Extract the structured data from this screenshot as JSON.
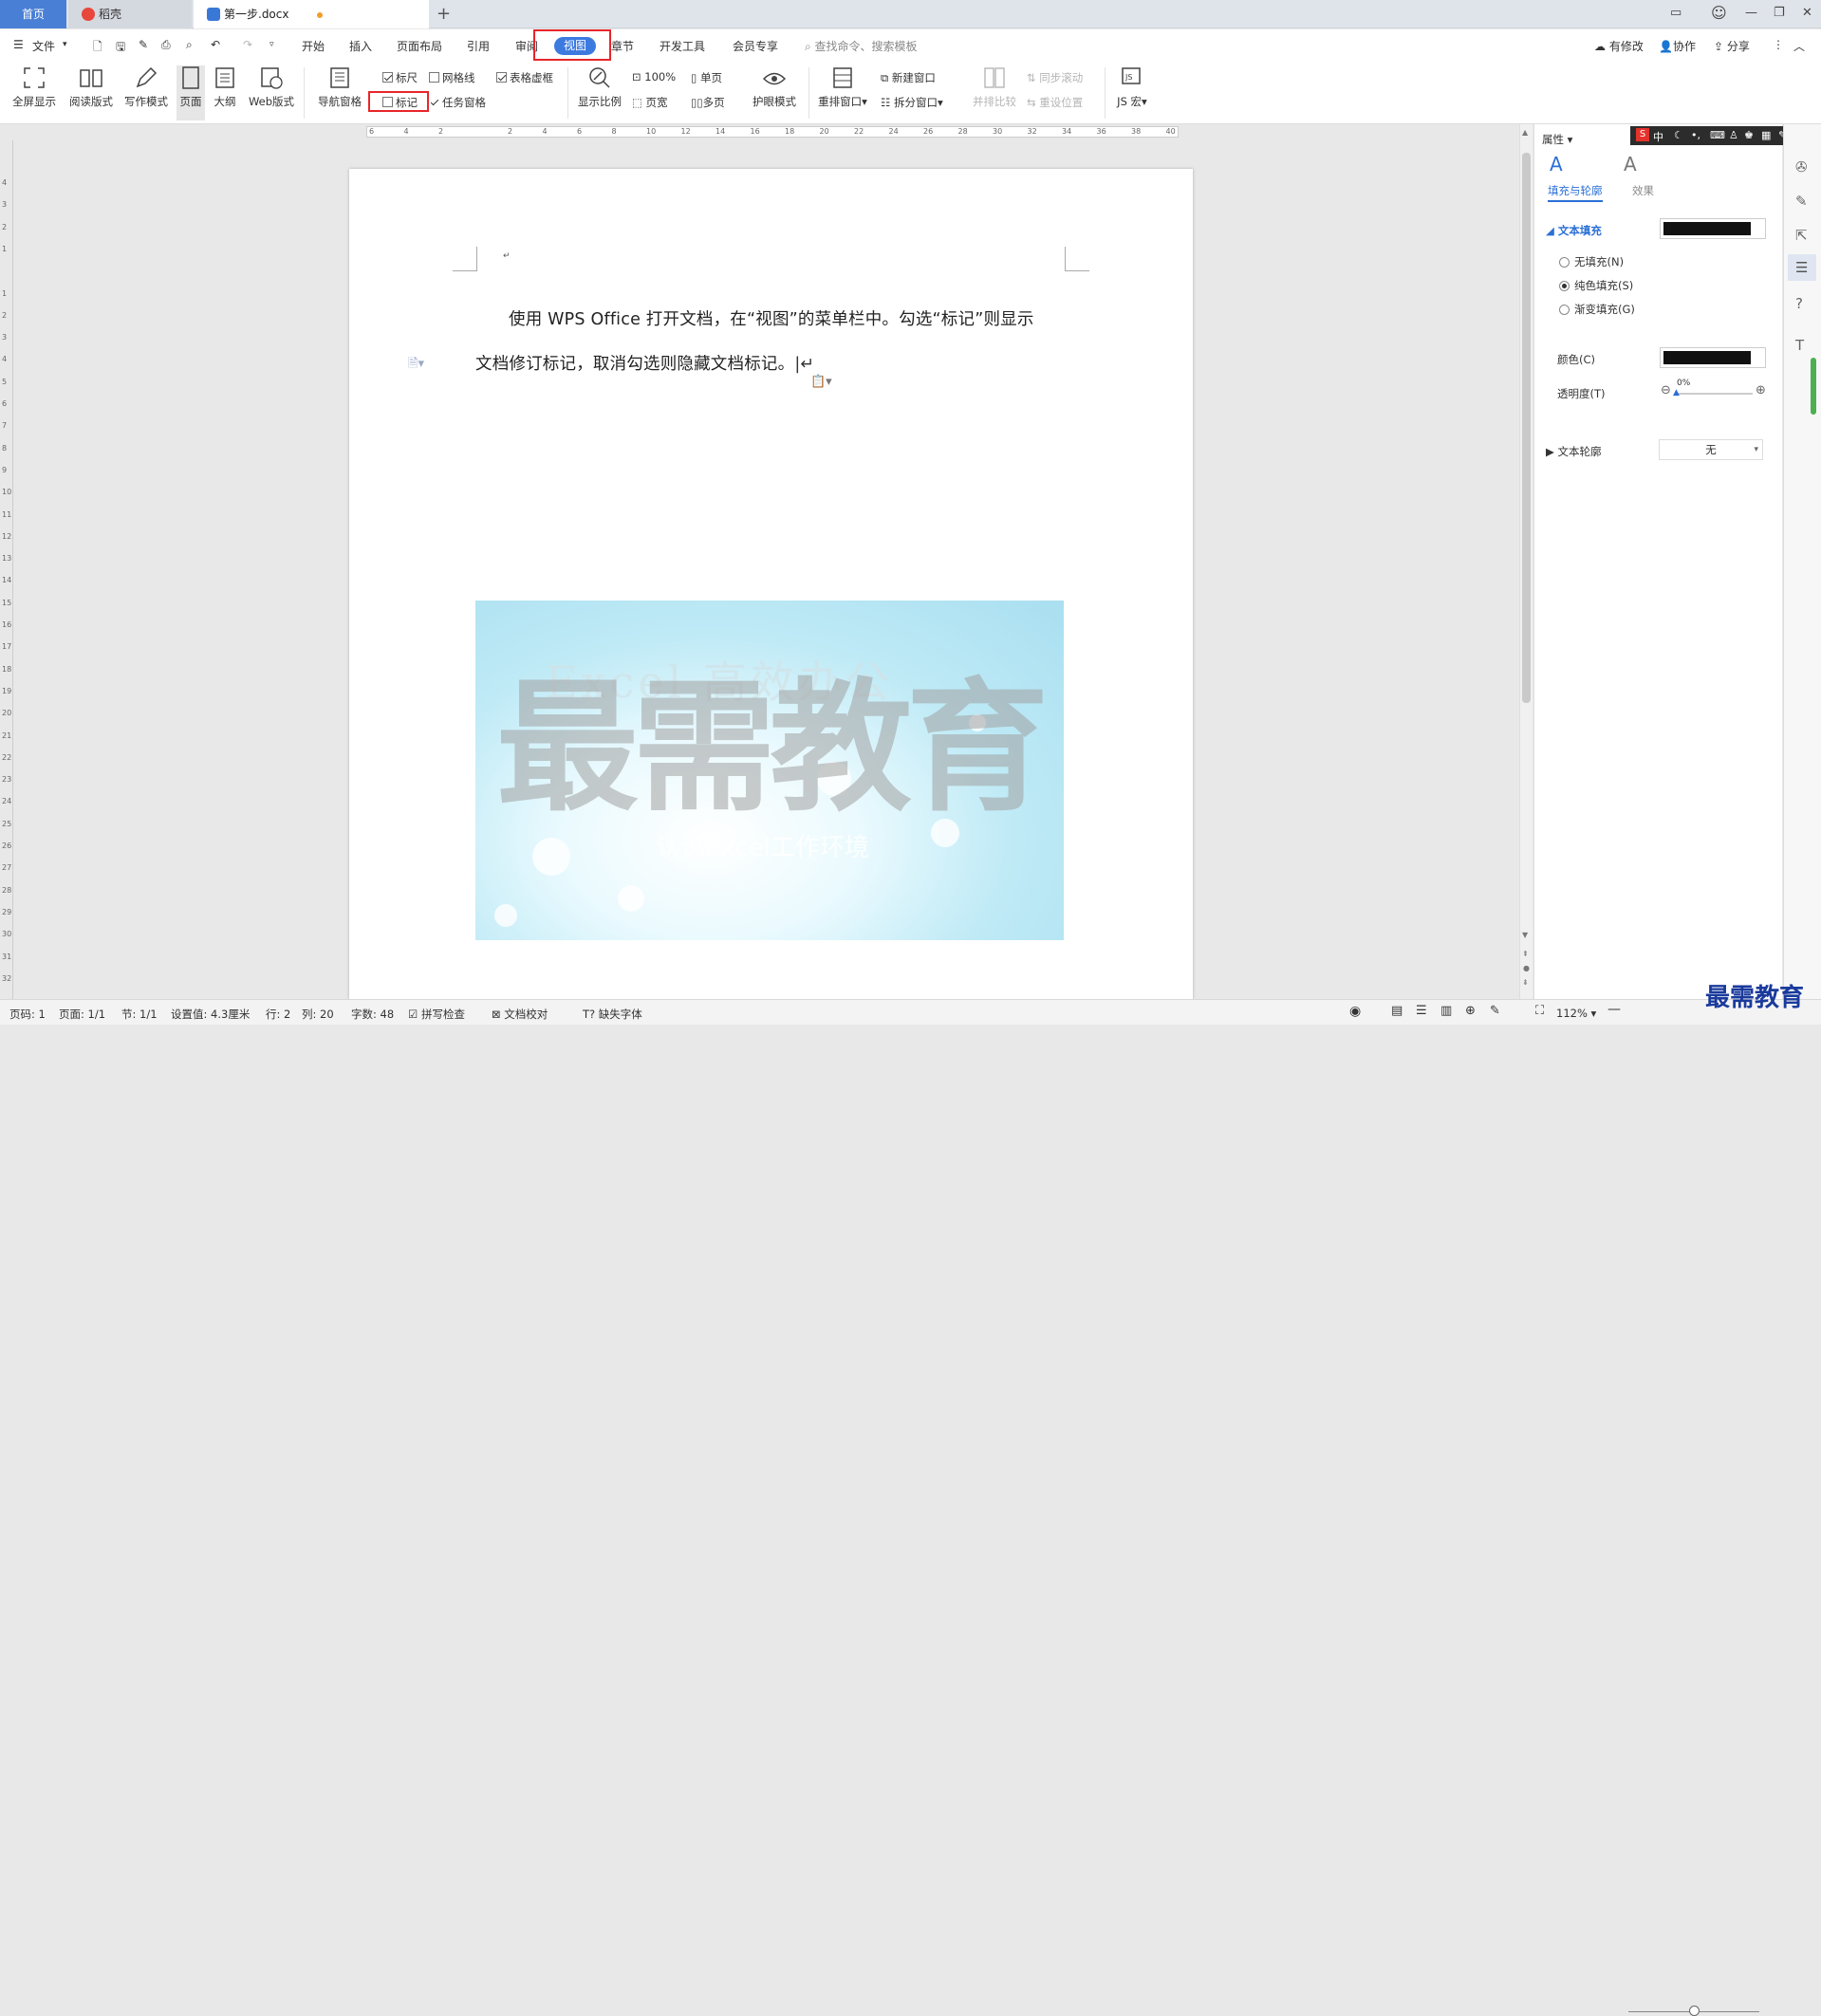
{
  "tabs": {
    "home": "首页",
    "daoke": "稻壳",
    "doc": "第一步.docx",
    "add": "+"
  },
  "menu": {
    "file": "文件",
    "items": [
      "开始",
      "插入",
      "页面布局",
      "引用",
      "审阅",
      "视图",
      "章节",
      "开发工具",
      "会员专享"
    ],
    "search": "查找命令、搜索模板",
    "right": [
      "有修改",
      "协作",
      "分享"
    ]
  },
  "ribbon": {
    "fullscreen": "全屏显示",
    "read": "阅读版式",
    "write": "写作模式",
    "page": "页面",
    "outline": "大纲",
    "web": "Web版式",
    "nav": "导航窗格",
    "ruler": "标尺",
    "gridline": "网格线",
    "tablegrid": "表格虚框",
    "mark": "标记",
    "taskpane": "任务窗格",
    "zoom": "显示比例",
    "zoom100": "100%",
    "single": "单页",
    "pagewidth": "页宽",
    "multi": "多页",
    "eyecare": "护眼模式",
    "arrange": "重排窗口",
    "newwin": "新建窗口",
    "split": "拆分窗口",
    "sidebyside": "并排比较",
    "syncscroll": "同步滚动",
    "resetpos": "重设位置",
    "macro": "JS 宏"
  },
  "ruler_ticks": [
    "6",
    "4",
    "2",
    "",
    "2",
    "4",
    "6",
    "8",
    "10",
    "12",
    "14",
    "16",
    "18",
    "20",
    "22",
    "24",
    "26",
    "28",
    "30",
    "32",
    "34",
    "36",
    "38",
    "40"
  ],
  "vruler_ticks": [
    "4",
    "3",
    "2",
    "1",
    "",
    "1",
    "2",
    "3",
    "4",
    "5",
    "6",
    "7",
    "8",
    "9",
    "10",
    "11",
    "12",
    "13",
    "14",
    "15",
    "16",
    "17",
    "18",
    "19",
    "20",
    "21",
    "22",
    "23",
    "24",
    "25",
    "26",
    "27",
    "28",
    "29",
    "30",
    "31",
    "32"
  ],
  "document": {
    "line1": "使用 WPS Office 打开文档，在“视图”的菜单栏中。勾选“标记”则显示",
    "line2": "文档修订标记，取消勾选则隐藏文档标记。",
    "watermark_big": "最需教育",
    "image_text1": "Excel 高效办公",
    "image_text2": "认识Excel工作环境"
  },
  "panel": {
    "title": "属性",
    "tab_fill": "填充与轮廓",
    "tab_effect": "效果",
    "text_fill": "文本填充",
    "no_fill": "无填充(N)",
    "solid_fill": "纯色填充(S)",
    "gradient_fill": "渐变填充(G)",
    "color": "颜色(C)",
    "transparency": "透明度(T)",
    "transparency_value": "0%",
    "text_outline": "文本轮廓",
    "outline_value": "无",
    "swatch_color": "#111111"
  },
  "ime": {
    "label": "中"
  },
  "status": {
    "page_no": "页码: 1",
    "pages": "页面: 1/1",
    "section": "节: 1/1",
    "setting": "设置值: 4.3厘米",
    "row": "行: 2",
    "col": "列: 20",
    "words": "字数: 48",
    "spell": "拼写检查",
    "proof": "文档校对",
    "missing_font": "缺失字体",
    "zoom": "112%"
  },
  "brand": "最需教育",
  "colors": {
    "accent": "#3c7ae0",
    "highlight": "#e8262b"
  }
}
